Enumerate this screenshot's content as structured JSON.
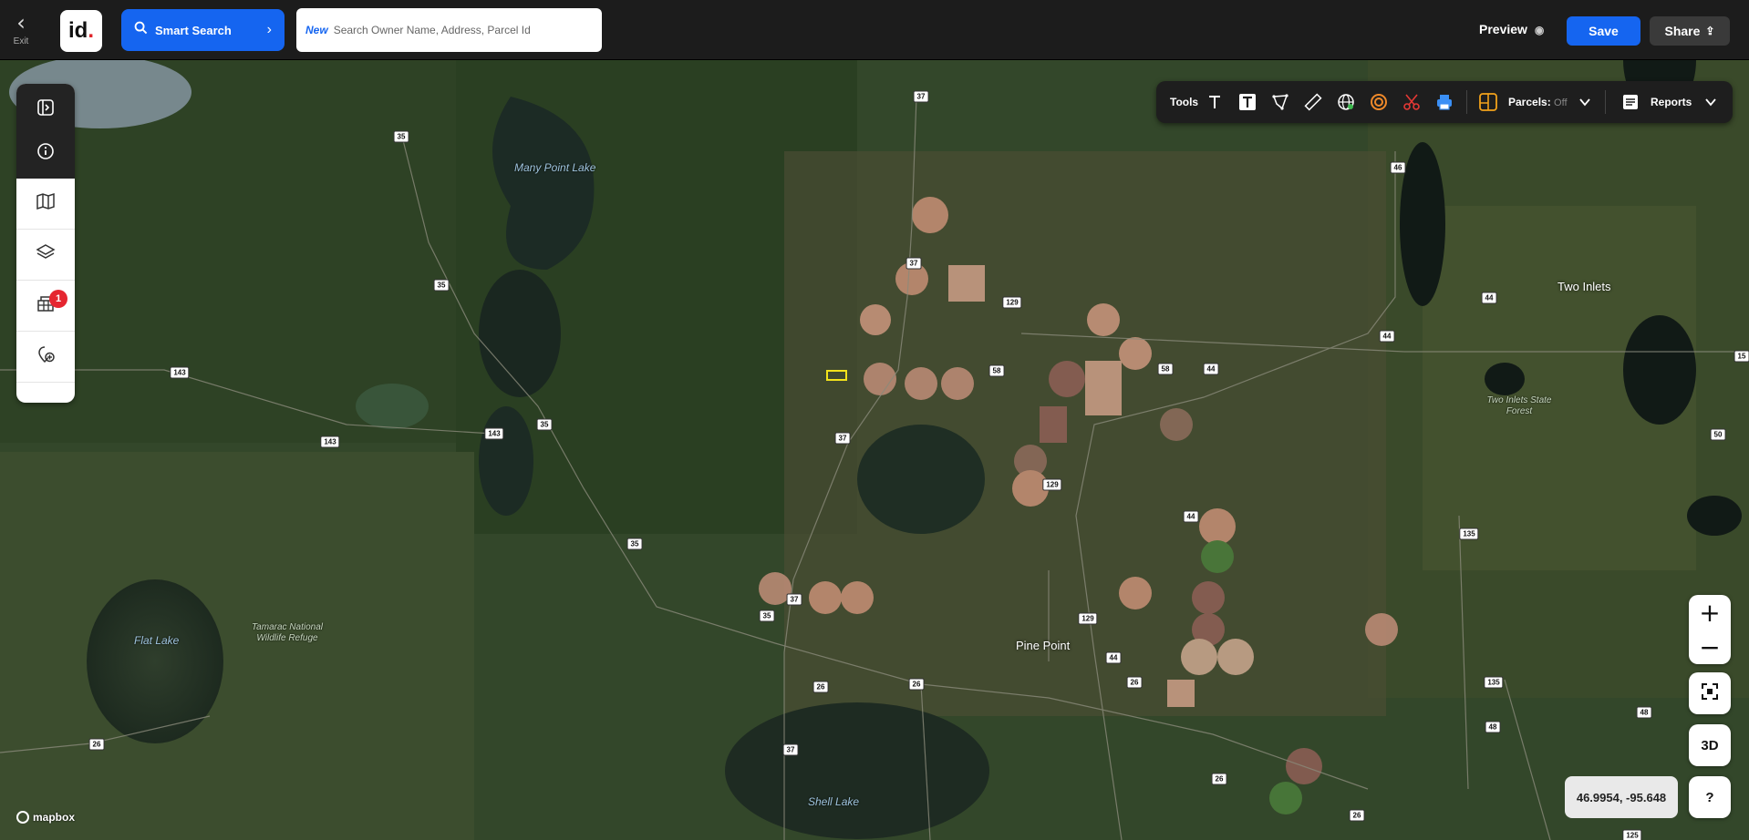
{
  "header": {
    "exit_label": "Exit",
    "logo_text": "id",
    "smart_search_label": "Smart Search",
    "search_new_tag": "New",
    "search_placeholder": "Search Owner Name, Address, Parcel Id",
    "preview_label": "Preview",
    "save_label": "Save",
    "share_label": "Share"
  },
  "left_panel": {
    "items": [
      {
        "icon": "collapse-panel-icon"
      },
      {
        "icon": "info-icon"
      },
      {
        "icon": "map-icon"
      },
      {
        "icon": "layers-icon"
      },
      {
        "icon": "parcels-icon",
        "badge": "1"
      },
      {
        "icon": "add-location-icon"
      }
    ]
  },
  "toolbar": {
    "tools_label": "Tools",
    "parcels_label": "Parcels:",
    "parcels_state": "Off",
    "reports_label": "Reports",
    "icons": [
      "text-icon",
      "text-box-icon",
      "draw-polygon-icon",
      "ruler-icon",
      "globe-icon",
      "radius-icon",
      "scissors-icon",
      "print-icon",
      "parcel-select-icon"
    ]
  },
  "map": {
    "places": [
      {
        "name": "Two Inlets"
      },
      {
        "name": "Pine Point"
      }
    ],
    "water": [
      {
        "name": "Many Point Lake"
      },
      {
        "name": "Flat Lake"
      },
      {
        "name": "Shell Lake"
      }
    ],
    "forests": [
      {
        "name": "Tamarac National Wildlife Refuge"
      },
      {
        "name": "Two Inlets State Forest"
      }
    ],
    "road_shields": [
      "37",
      "35",
      "46",
      "37",
      "129",
      "35",
      "143",
      "58",
      "58",
      "44",
      "44",
      "44",
      "15",
      "143",
      "143",
      "35",
      "37",
      "129",
      "50",
      "44",
      "135",
      "35",
      "37",
      "35",
      "129",
      "44",
      "26",
      "26",
      "26",
      "135",
      "48",
      "48",
      "26",
      "37",
      "26",
      "26",
      "125"
    ]
  },
  "controls": {
    "zoom_in": "+",
    "zoom_out": "−",
    "three_d_label": "3D",
    "help_label": "?",
    "coordinates": "46.9954, -95.648",
    "attribution": "mapbox"
  },
  "colors": {
    "accent": "#1565f0",
    "badge": "#e52630",
    "toolbar_bg": "#1e1e1e"
  }
}
